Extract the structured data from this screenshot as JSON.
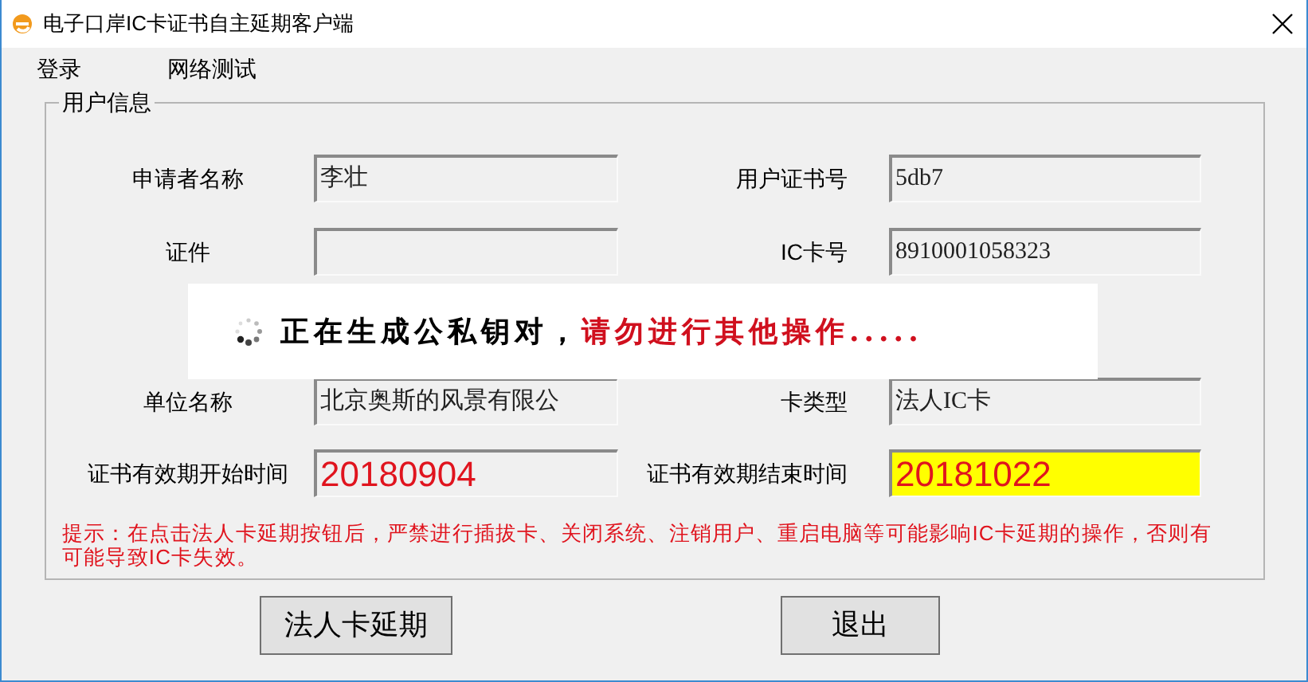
{
  "window": {
    "title": "电子口岸IC卡证书自主延期客户端"
  },
  "menu": [
    "登录",
    "网络测试"
  ],
  "user_info": {
    "title": "用户信息",
    "rows": [
      {
        "left": {
          "label": "申请者名称",
          "value": "李壮",
          "kind": "text",
          "highlighted": false
        },
        "right": {
          "label": "用户证书号",
          "value": "5db7",
          "kind": "text",
          "highlighted": false
        }
      },
      {
        "left": {
          "label": "证件",
          "kind": "text",
          "highlighted": false
        },
        "right": {
          "label": "IC卡号",
          "value": "8910001058323",
          "kind": "text",
          "highlighted": false
        }
      },
      {
        "left": {
          "label": "单位名称",
          "value": "北京奥斯的风景有限公",
          "kind": "text",
          "highlighted": false
        },
        "right": {
          "label": "卡类型",
          "value": "法人IC卡",
          "kind": "text",
          "highlighted": false
        }
      },
      {
        "left": {
          "label": "证书有效期开始时间",
          "value": "20180904",
          "kind": "date",
          "highlighted": false
        },
        "right": {
          "label": "证书有效期结束时间",
          "value": "20181022",
          "kind": "date",
          "highlighted": true
        }
      }
    ],
    "note": "提示：在点击法人卡延期按钮后，严禁进行插拔卡、关闭系统、注销用户、重启电脑等可能影响IC卡延期的操作，否则有可能导致IC卡失效。"
  },
  "buttons": [
    "法人卡延期",
    "退出"
  ],
  "progress": {
    "message": "正在生成公私钥对，",
    "warning": "请勿进行其他操作....."
  }
}
